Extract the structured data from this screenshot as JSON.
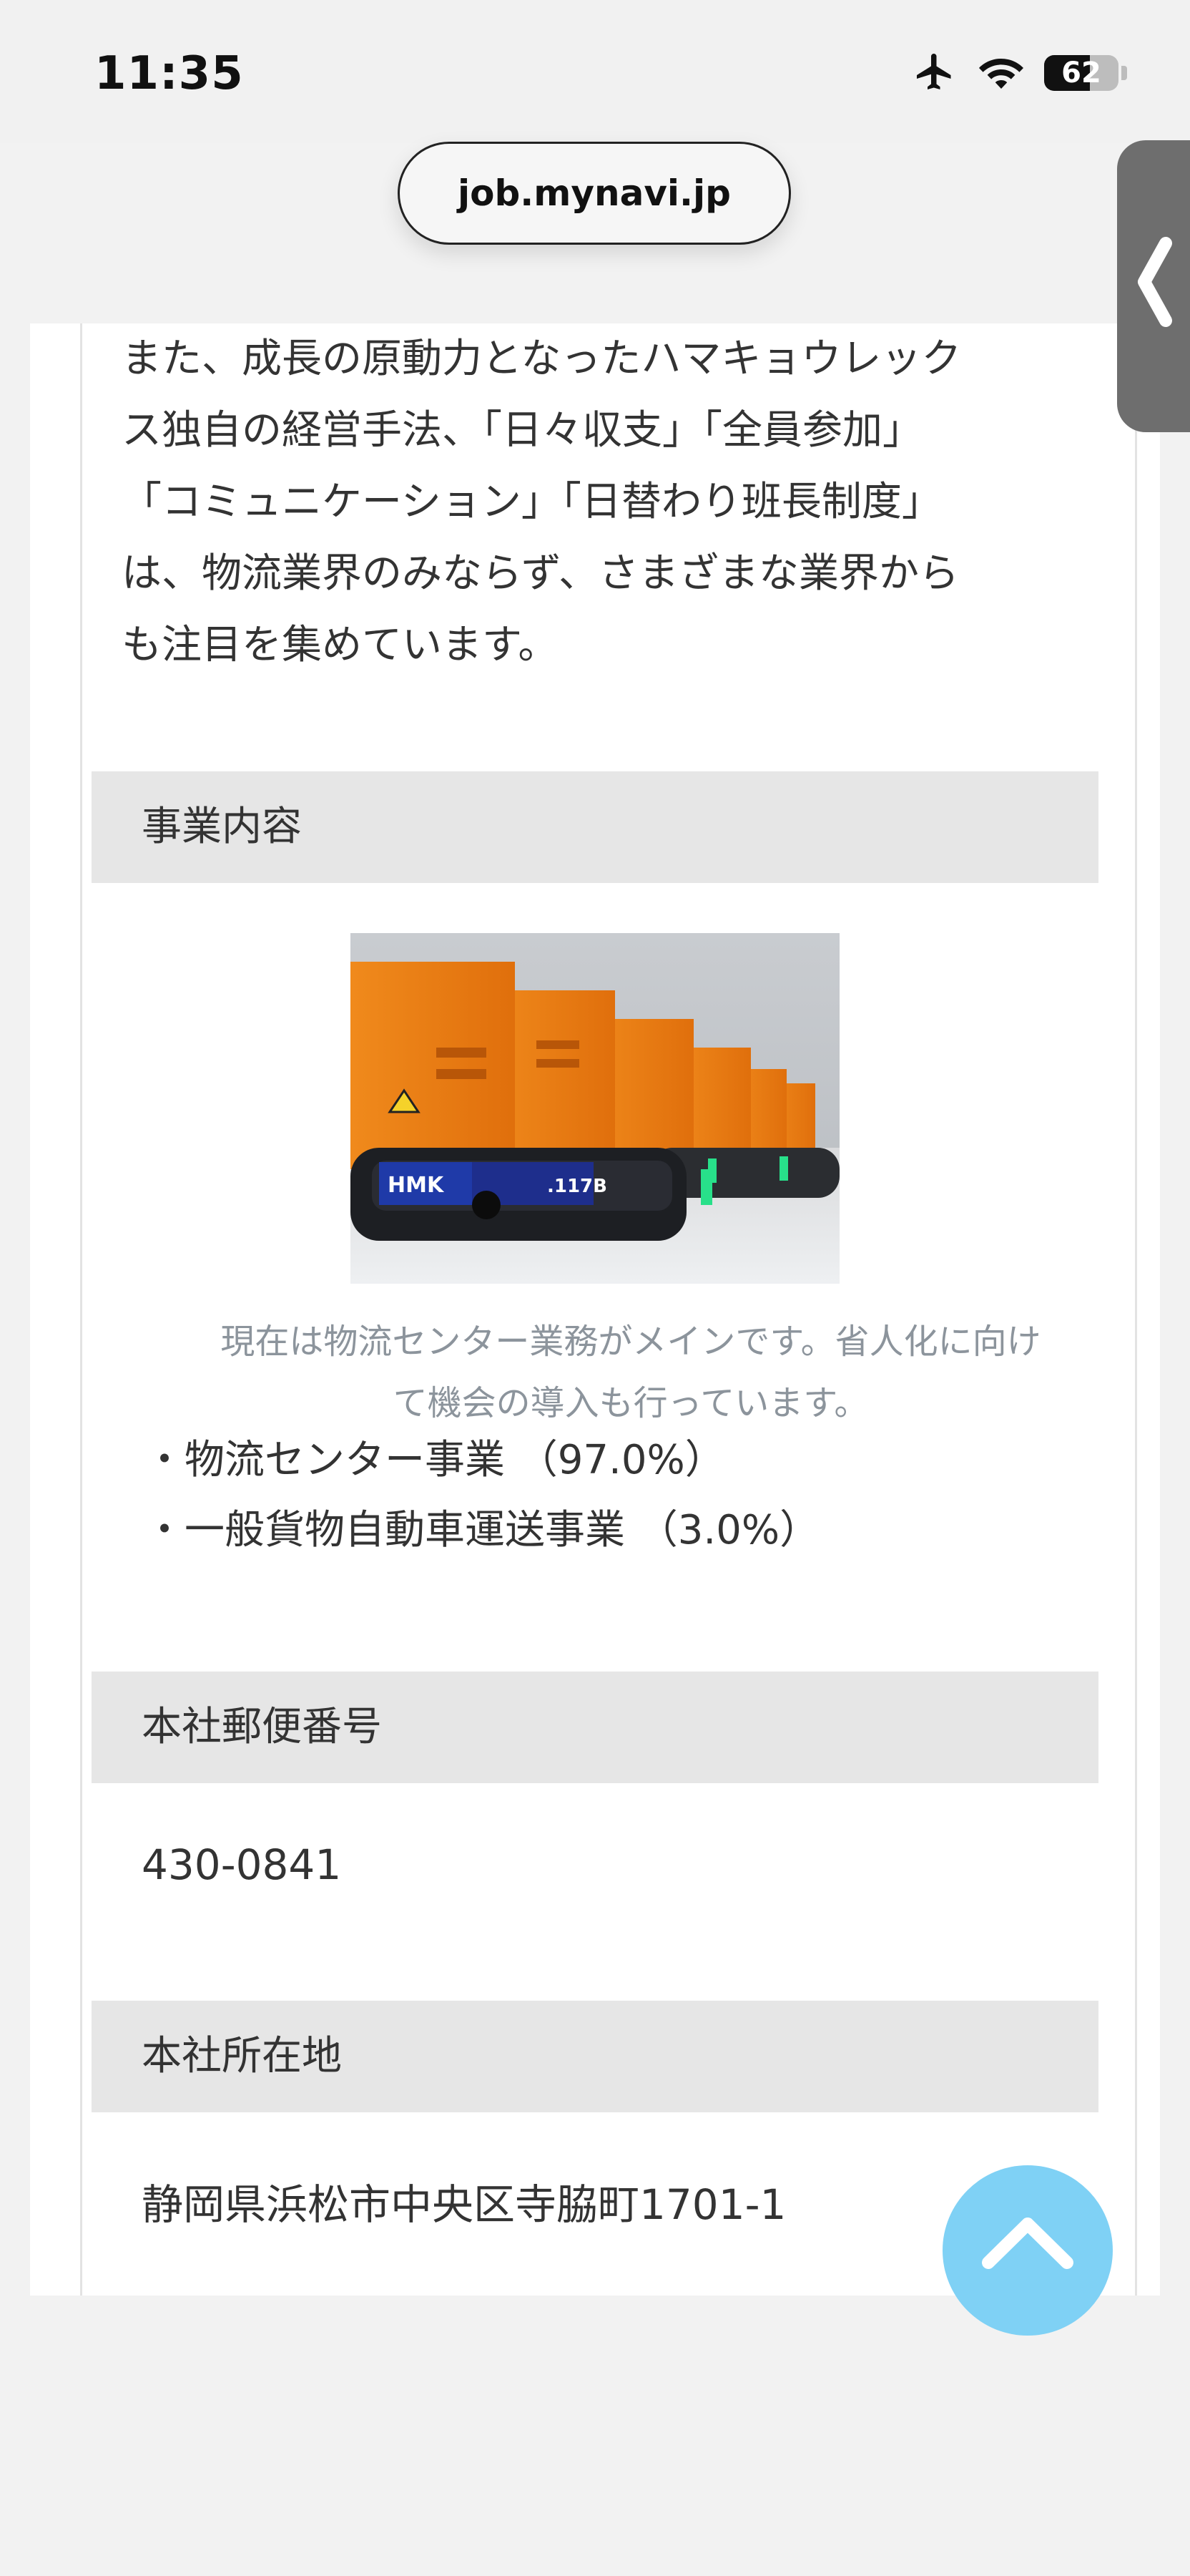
{
  "status_bar": {
    "time": "11:35",
    "battery_percent": "62",
    "battery_level": 0.62
  },
  "browser": {
    "url": "job.mynavi.jp"
  },
  "intro": {
    "lines": [
      "また、成長の原動力となったハマキョウレック",
      "ス独自の経営手法、「日々収支」「全員参加」",
      "「コミュニケーション」「日替わり班長制度」",
      "は、物流業界のみならず、さまざまな業界から",
      "も注目を集めています。"
    ]
  },
  "business": {
    "header": "事業内容",
    "photo_label": ".117B",
    "photo_logo": "HMK",
    "caption_lines": [
      "現在は物流センター業務がメインです。省人化に向け",
      "て機会の導入も行っています。"
    ],
    "items": [
      "・物流センター事業 （97.0%）",
      "・一般貨物自動車運送事業 （3.0%）"
    ]
  },
  "postal": {
    "header": "本社郵便番号",
    "value": "430-0841"
  },
  "address": {
    "header": "本社所在地",
    "value": "静岡県浜松市中央区寺脇町1701-1"
  },
  "icons": {
    "status": [
      "airplane-icon",
      "wifi-icon",
      "battery-icon"
    ],
    "side_tab": "chevron-left-icon",
    "scroll_top": "chevron-up-icon"
  },
  "colors": {
    "scroll_top_button": "#7fd1f5",
    "section_header_bg": "#e6e6e6",
    "side_tab": "#6e6e6e",
    "caption_text": "#8c949c"
  }
}
